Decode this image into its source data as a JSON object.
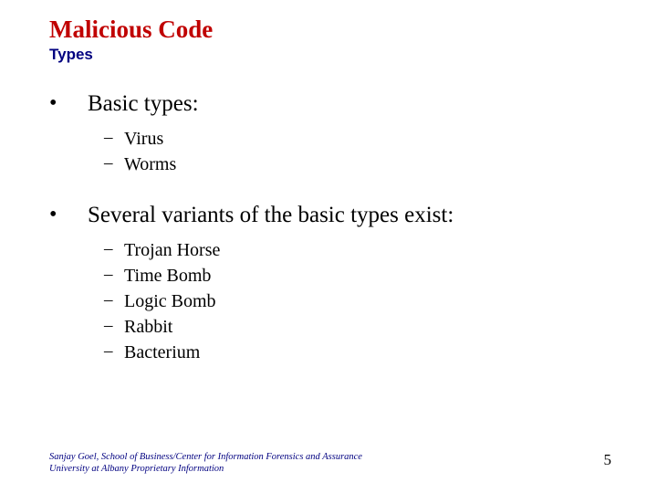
{
  "title": "Malicious Code",
  "subtitle": "Types",
  "sections": [
    {
      "heading": "Basic types:",
      "items": [
        "Virus",
        "Worms"
      ]
    },
    {
      "heading": "Several variants of the basic types exist:",
      "items": [
        "Trojan Horse",
        "Time Bomb",
        "Logic Bomb",
        "Rabbit",
        "Bacterium"
      ]
    }
  ],
  "footer": {
    "line1": "Sanjay Goel, School of Business/Center for Information Forensics and Assurance",
    "line2": "University at Albany Proprietary Information"
  },
  "page_number": "5"
}
